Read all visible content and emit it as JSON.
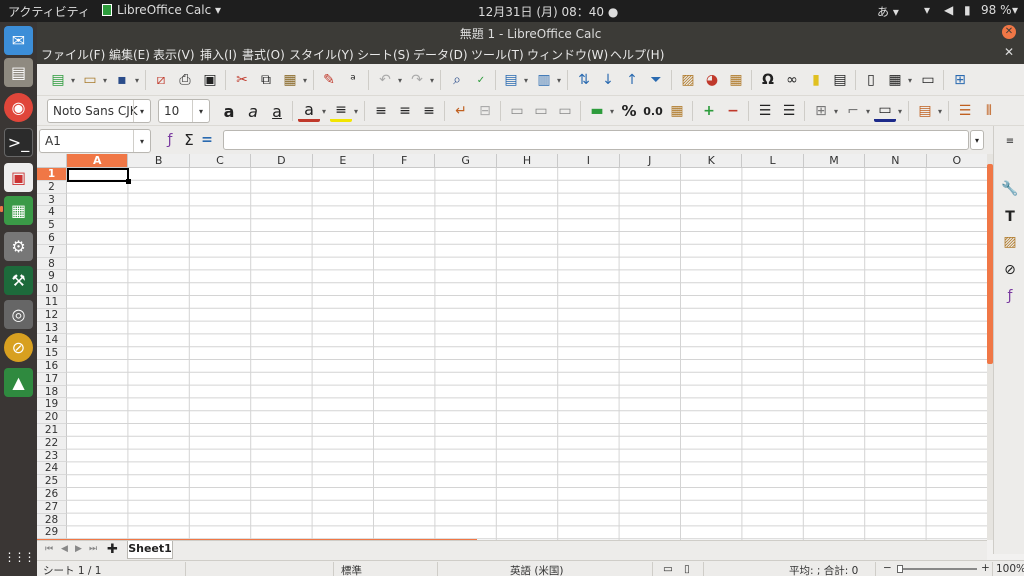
{
  "topbar": {
    "activities": "アクティビティ",
    "app_menu": "LibreOffice Calc ▾",
    "clock": "12月31日 (月) 08：40",
    "ime": "あ ▾",
    "battery": "98 %"
  },
  "dock": {
    "items": [
      "thunderbird-icon",
      "files-icon",
      "chrome-icon",
      "terminal-icon",
      "document-viewer-icon",
      "libreoffice-calc-icon",
      "settings-icon",
      "android-studio-icon",
      "disk-icon",
      "ubuntu-software-icon",
      "system-monitor-icon"
    ],
    "apps_grid": "⋮⋮⋮"
  },
  "window": {
    "title": "無題 1 - LibreOffice Calc"
  },
  "menubar": {
    "items": [
      "ファイル(F)",
      "編集(E)",
      "表示(V)",
      "挿入(I)",
      "書式(O)",
      "スタイル(Y)",
      "シート(S)",
      "データ(D)",
      "ツール(T)",
      "ウィンドウ(W)",
      "ヘルプ(H)"
    ]
  },
  "format_toolbar": {
    "font_name": "Noto Sans CJK",
    "font_size": "10"
  },
  "formula_bar": {
    "name_box": "A1",
    "formula": ""
  },
  "grid": {
    "columns": [
      "A",
      "B",
      "C",
      "D",
      "E",
      "F",
      "G",
      "H",
      "I",
      "J",
      "K",
      "L",
      "M",
      "N",
      "O"
    ],
    "rows": [
      "1",
      "2",
      "3",
      "4",
      "5",
      "6",
      "7",
      "8",
      "9",
      "10",
      "11",
      "12",
      "13",
      "14",
      "15",
      "16",
      "17",
      "18",
      "19",
      "20",
      "21",
      "22",
      "23",
      "24",
      "25",
      "26",
      "27",
      "28",
      "29"
    ],
    "selected_cell": "A1"
  },
  "sheet_tabs": {
    "tabs": [
      "Sheet1"
    ]
  },
  "statusbar": {
    "sheet_position": "シート 1 / 1",
    "page_style": "標準",
    "language": "英語 (米国)",
    "summary": "平均: ; 合計: 0",
    "zoom_minus": "−",
    "zoom_plus": "+",
    "zoom": "100%"
  },
  "colors": {
    "accent": "#f07746",
    "titlebar": "#3c3b37",
    "topbar": "#1e1e1e",
    "dock": "#3a3634"
  }
}
